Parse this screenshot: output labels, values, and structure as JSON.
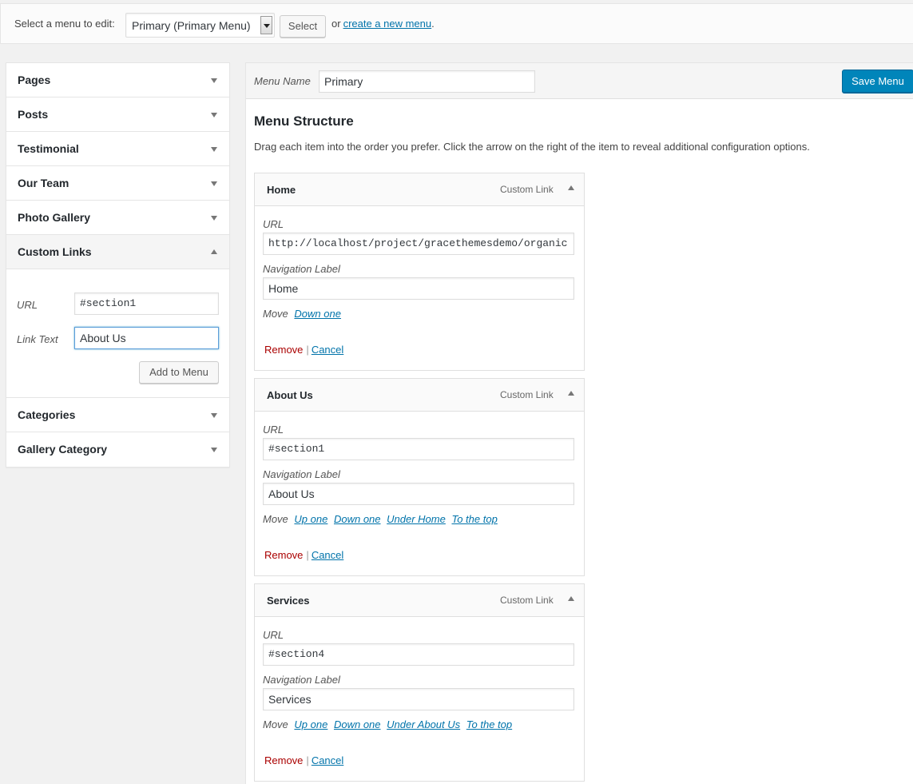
{
  "topbar": {
    "label": "Select a menu to edit:",
    "selected_menu": "Primary (Primary Menu)",
    "select_button": "Select",
    "or_text": "or",
    "create_link": "create a new menu",
    "period": "."
  },
  "accordion": {
    "items_top": [
      {
        "label": "Pages"
      },
      {
        "label": "Posts"
      },
      {
        "label": "Testimonial"
      },
      {
        "label": "Our Team"
      },
      {
        "label": "Photo Gallery"
      },
      {
        "label": "Custom Links"
      }
    ],
    "custom_links": {
      "url_label": "URL",
      "url_value": "#section1",
      "link_text_label": "Link Text",
      "link_text_value": "About Us",
      "add_button": "Add to Menu"
    },
    "items_bottom": [
      {
        "label": "Categories"
      },
      {
        "label": "Gallery Category"
      }
    ]
  },
  "menu": {
    "name_label": "Menu Name",
    "name_value": "Primary",
    "save_button": "Save Menu",
    "structure_title": "Menu Structure",
    "structure_desc": "Drag each item into the order you prefer. Click the arrow on the right of the item to reveal additional configuration options.",
    "common": {
      "type": "Custom Link",
      "url_label": "URL",
      "nav_label": "Navigation Label",
      "move_label": "Move",
      "remove": "Remove",
      "sep": "|",
      "cancel": "Cancel"
    },
    "items": [
      {
        "title": "Home",
        "url": "http://localhost/project/gracethemesdemo/organic",
        "nav_label": "Home",
        "move_links": [
          "Down one"
        ]
      },
      {
        "title": "About Us",
        "url": "#section1",
        "nav_label": "About Us",
        "move_links": [
          "Up one",
          "Down one",
          "Under Home",
          "To the top"
        ]
      },
      {
        "title": "Services",
        "url": "#section4",
        "nav_label": "Services",
        "move_links": [
          "Up one",
          "Down one",
          "Under About Us",
          "To the top"
        ]
      }
    ]
  }
}
